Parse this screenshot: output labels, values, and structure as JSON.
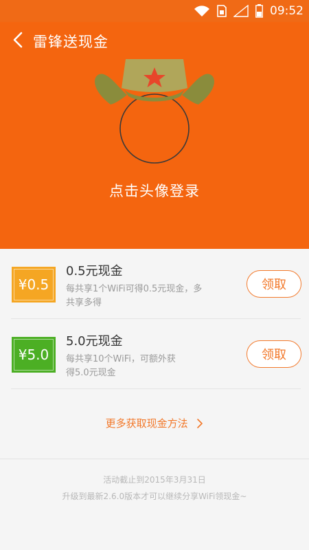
{
  "status_bar": {
    "time": "09:52",
    "icons": [
      "wifi-icon",
      "sim-card-icon",
      "signal-icon",
      "battery-icon"
    ]
  },
  "header": {
    "title": "雷锋送现金",
    "login_prompt": "点击头像登录"
  },
  "rewards": [
    {
      "badge": "¥0.5",
      "badge_color": "#f5a623",
      "title": "0.5元现金",
      "description_line1": "每共享1个WiFi可得0.5元现金，多",
      "description_line2": "共享多得",
      "button_label": "领取"
    },
    {
      "badge": "¥5.0",
      "badge_color": "#4caf24",
      "title": "5.0元现金",
      "description_line1": "每共享10个WiFi，可额外获",
      "description_line2": "得5.0元现金",
      "button_label": "领取"
    }
  ],
  "more_methods": {
    "label": "更多获取现金方法"
  },
  "footer": {
    "deadline": "活动截止到2015年3月31日",
    "upgrade_note": "升级到最新2.6.0版本才可以继续分享WiFi领现金~"
  },
  "colors": {
    "header_orange": "#f4650f",
    "accent_orange": "#f2782a",
    "hat_olive": "#8a8c3c",
    "star_red": "#e8462a"
  }
}
